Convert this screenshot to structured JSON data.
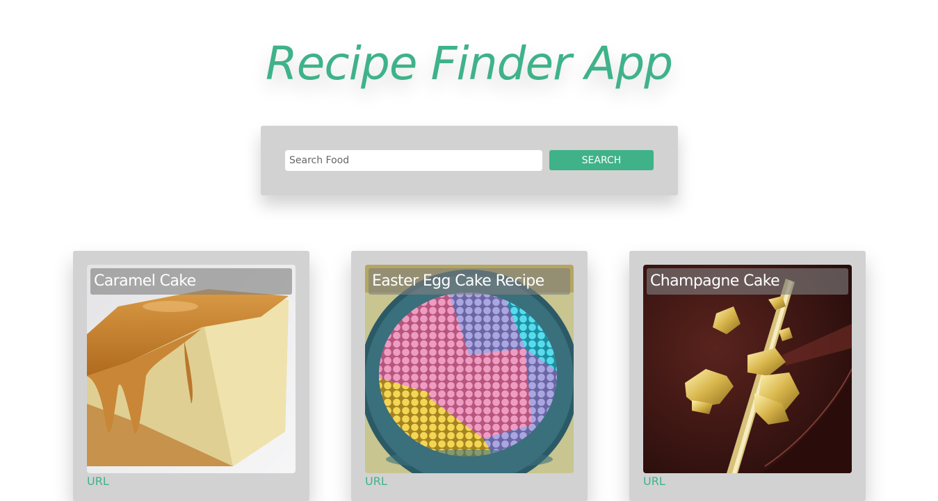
{
  "header": {
    "title": "Recipe Finder App"
  },
  "search": {
    "placeholder": "Search Food",
    "value": "",
    "button_label": "SEARCH"
  },
  "recipes": [
    {
      "title": "Caramel Cake",
      "link_label": "URL",
      "image": "caramel-cake-photo"
    },
    {
      "title": "Easter Egg Cake Recipe",
      "link_label": "URL",
      "image": "easter-egg-cake-photo"
    },
    {
      "title": "Champagne Cake",
      "link_label": "URL",
      "image": "champagne-cake-photo"
    }
  ],
  "colors": {
    "accent": "#3fb28a",
    "panel": "#d2d2d2",
    "background": "#ffffff"
  }
}
